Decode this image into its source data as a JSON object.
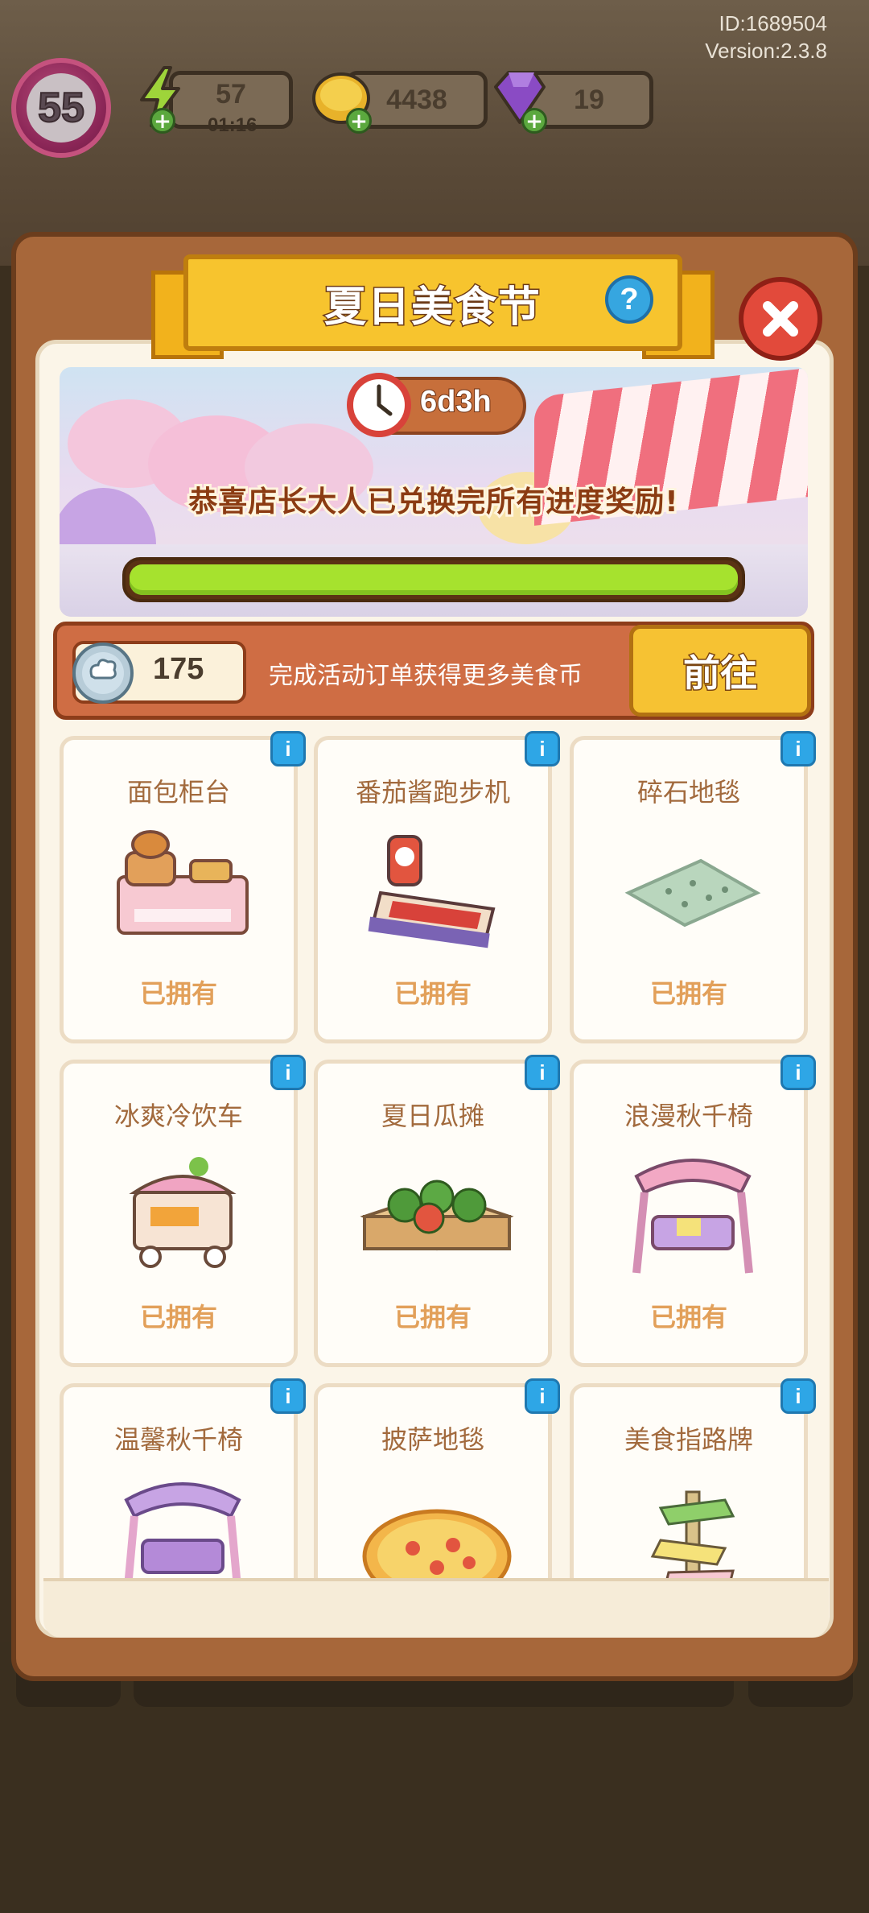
{
  "header": {
    "id_text": "ID:1689504",
    "version_text": "Version:2.3.8"
  },
  "hud": {
    "level": "55",
    "energy": "57",
    "energy_timer": "01:16",
    "coins": "4438",
    "gems": "19"
  },
  "panel": {
    "title": "夏日美食节",
    "help_label": "?",
    "timer": "6d3h",
    "congrats_text": "恭喜店长大人已兑换完所有进度奖励!",
    "progress": 1.0,
    "food_coin_count": "175",
    "food_coin_desc": "完成活动订单获得更多美食币",
    "go_button": "前往"
  },
  "items": [
    {
      "name": "面包柜台",
      "status": "已拥有",
      "icon": "bread-counter-icon"
    },
    {
      "name": "番茄酱跑步机",
      "status": "已拥有",
      "icon": "ketchup-treadmill-icon"
    },
    {
      "name": "碎石地毯",
      "status": "已拥有",
      "icon": "gravel-rug-icon"
    },
    {
      "name": "冰爽冷饮车",
      "status": "已拥有",
      "icon": "drink-cart-icon"
    },
    {
      "name": "夏日瓜摊",
      "status": "已拥有",
      "icon": "melon-stall-icon"
    },
    {
      "name": "浪漫秋千椅",
      "status": "已拥有",
      "icon": "pink-swing-icon"
    },
    {
      "name": "温馨秋千椅",
      "status": "",
      "icon": "purple-swing-icon"
    },
    {
      "name": "披萨地毯",
      "status": "",
      "icon": "pizza-rug-icon"
    },
    {
      "name": "美食指路牌",
      "status": "",
      "icon": "signpost-icon"
    }
  ],
  "info_label": "i",
  "colors": {
    "panel_brown": "#a7673a",
    "ribbon_yellow": "#f7c42e",
    "progress_green": "#a6e22e",
    "owned_text": "#e2a05a",
    "close_red": "#e24a3b",
    "info_blue": "#2ea6e6"
  }
}
